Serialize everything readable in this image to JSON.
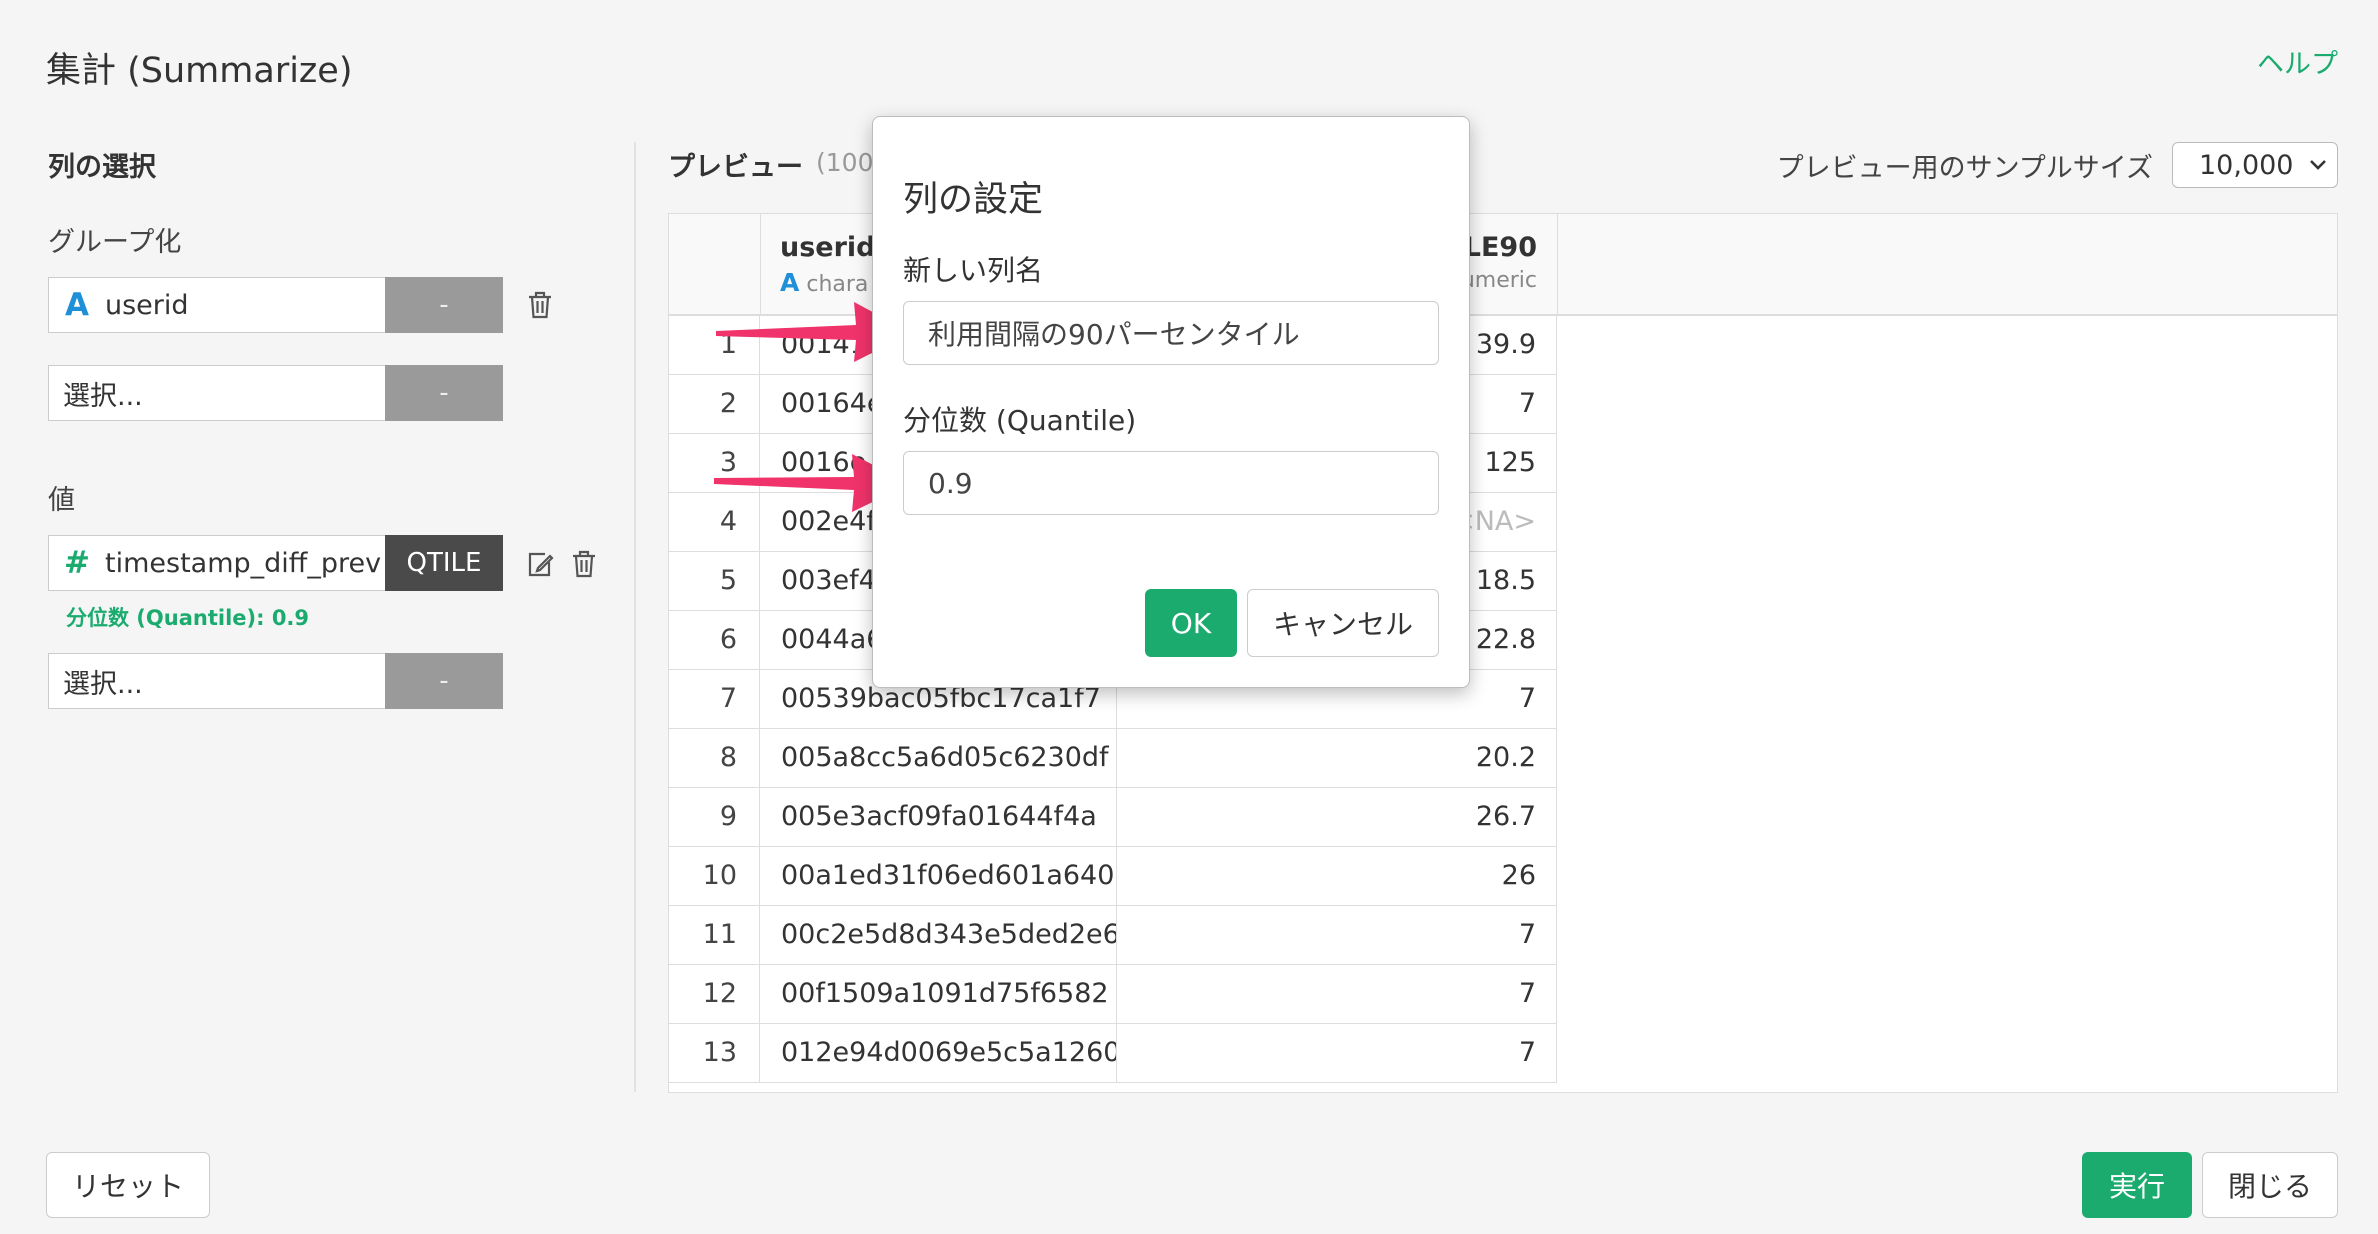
{
  "header": {
    "title": "集計 (Summarize)",
    "help": "ヘルプ"
  },
  "left": {
    "section_title": "列の選択",
    "group_label": "グループ化",
    "group_rows": [
      {
        "icon": "A",
        "name": "userid",
        "fn": "-"
      },
      {
        "placeholder": "選択...",
        "fn": "-"
      }
    ],
    "value_label": "値",
    "value_rows": [
      {
        "icon": "#",
        "name": "timestamp_diff_prev",
        "fn": "QTILE",
        "note": "分位数 (Quantile): 0.9"
      },
      {
        "placeholder": "選択...",
        "fn": "-"
      }
    ]
  },
  "preview": {
    "title": "プレビュー",
    "count": "(100",
    "sample_label": "プレビュー用のサンプルサイズ",
    "sample_value": "10,000",
    "columns": [
      {
        "name": "userid",
        "type_icon": "A",
        "type": "chara"
      },
      {
        "name": "LE90",
        "type": "umeric"
      }
    ],
    "rows": [
      {
        "i": "1",
        "a": "00141f",
        "b": "39.9"
      },
      {
        "i": "2",
        "a": "00164e",
        "b": "7"
      },
      {
        "i": "3",
        "a": "0016e",
        "b": "125"
      },
      {
        "i": "4",
        "a": "002e4f",
        "b": "<NA>"
      },
      {
        "i": "5",
        "a": "003ef43",
        "b": "18.5"
      },
      {
        "i": "6",
        "a": "0044a6",
        "b": "22.8"
      },
      {
        "i": "7",
        "a": "00539bac05fbc17ca1f7",
        "b": "7"
      },
      {
        "i": "8",
        "a": "005a8cc5a6d05c6230df",
        "b": "20.2"
      },
      {
        "i": "9",
        "a": "005e3acf09fa01644f4a",
        "b": "26.7"
      },
      {
        "i": "10",
        "a": "00a1ed31f06ed601a640",
        "b": "26"
      },
      {
        "i": "11",
        "a": "00c2e5d8d343e5ded2e6",
        "b": "7"
      },
      {
        "i": "12",
        "a": "00f1509a1091d75f6582",
        "b": "7"
      },
      {
        "i": "13",
        "a": "012e94d0069e5c5a1260",
        "b": "7"
      }
    ]
  },
  "modal": {
    "title": "列の設定",
    "name_label": "新しい列名",
    "name_value": "利用間隔の90パーセンタイル",
    "quantile_label": "分位数 (Quantile)",
    "quantile_value": "0.9",
    "ok": "OK",
    "cancel": "キャンセル"
  },
  "footer": {
    "reset": "リセット",
    "run": "実行",
    "close": "閉じる"
  },
  "colors": {
    "accent": "#1bab6f",
    "arrow": "#f0336b",
    "char_icon": "#1f8fd8",
    "num_icon": "#1bab6f"
  }
}
